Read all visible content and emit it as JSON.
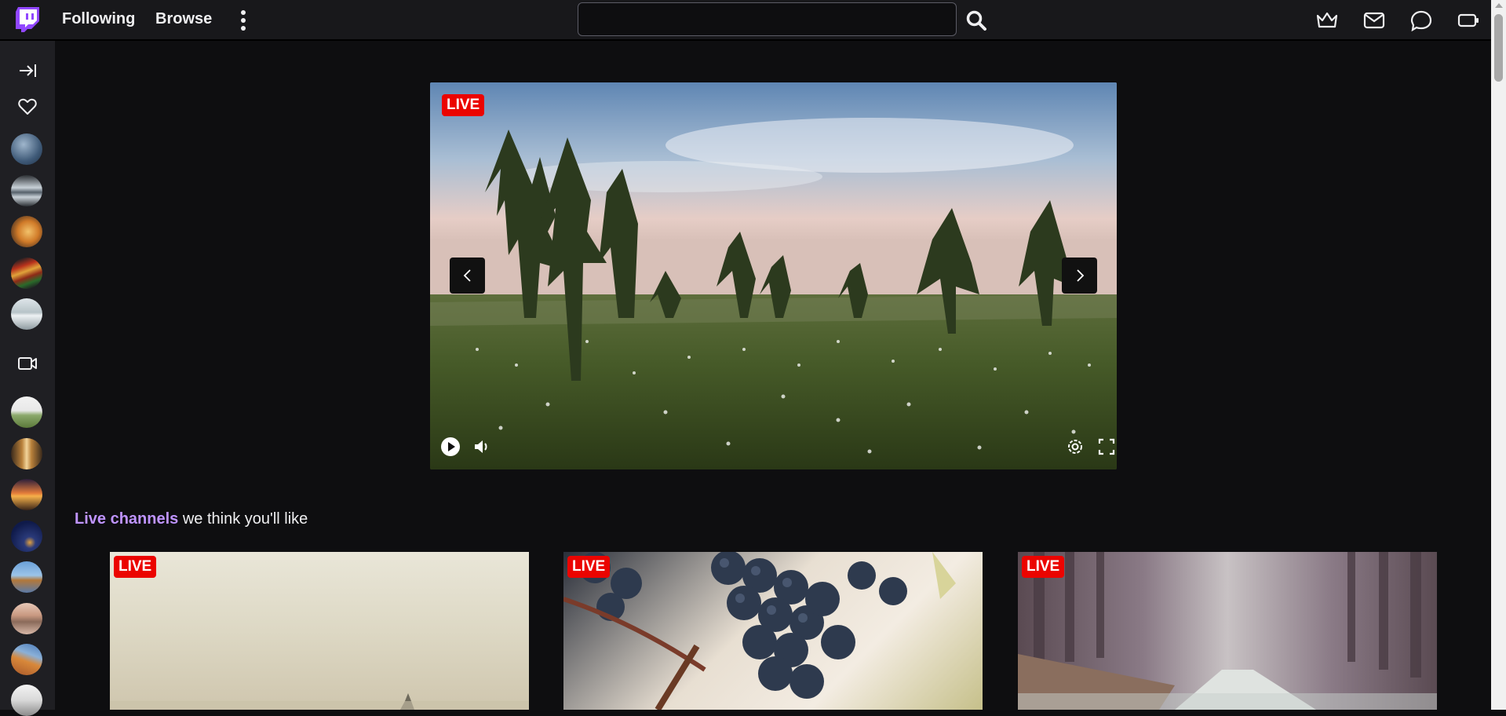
{
  "nav": {
    "following": "Following",
    "browse": "Browse",
    "search_placeholder": "",
    "search_value": ""
  },
  "player": {
    "live_label": "LIVE"
  },
  "section": {
    "accent": "Live channels",
    "rest": " we think you'll like"
  },
  "cards": [
    {
      "live_label": "LIVE"
    },
    {
      "live_label": "LIVE"
    },
    {
      "live_label": "LIVE"
    }
  ],
  "colors": {
    "accent": "#bf94ff",
    "brand": "#9147ff",
    "live": "#eb0400",
    "background": "#0e0e10",
    "nav": "#18181b",
    "sidebar": "#1f1f23"
  },
  "icons": {
    "logo": "twitch-logo-icon",
    "more": "vertical-dots-icon",
    "search": "search-icon",
    "prime": "crown-icon",
    "inbox": "mail-icon",
    "whispers": "chat-bubble-icon",
    "bits": "battery-icon",
    "collapse": "collapse-sidebar-icon",
    "followed": "heart-icon",
    "live_channels": "video-camera-icon"
  }
}
